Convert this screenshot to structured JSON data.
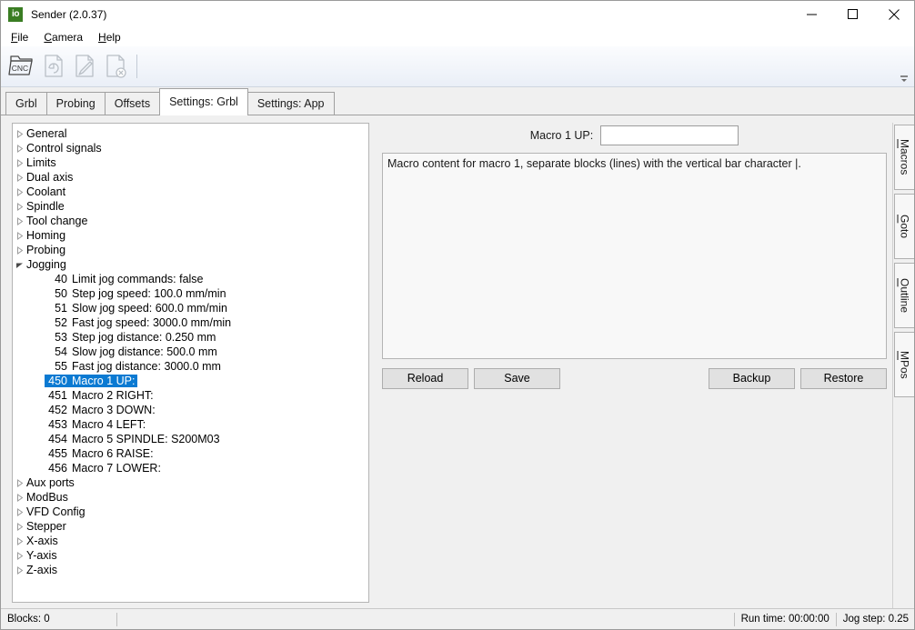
{
  "window": {
    "icon_text": "io",
    "title": "Sender (2.0.37)",
    "controls": {
      "minimize": "minimize-icon",
      "maximize": "maximize-icon",
      "close": "close-icon"
    }
  },
  "menubar": {
    "items": [
      {
        "mnemonic": "F",
        "rest": "ile"
      },
      {
        "mnemonic": "C",
        "rest": "amera"
      },
      {
        "mnemonic": "H",
        "rest": "elp"
      }
    ]
  },
  "toolbar": {
    "buttons": [
      {
        "name": "open-cnc-file-icon",
        "label": "CNC"
      },
      {
        "name": "reload-file-icon",
        "label": ""
      },
      {
        "name": "edit-file-icon",
        "label": ""
      },
      {
        "name": "close-file-icon",
        "label": ""
      }
    ],
    "overflow": "toolbar-overflow-icon"
  },
  "tabs": {
    "items": [
      {
        "label": "Grbl",
        "active": false
      },
      {
        "label": "Probing",
        "active": false
      },
      {
        "label": "Offsets",
        "active": false
      },
      {
        "label": "Settings: Grbl",
        "active": true
      },
      {
        "label": "Settings: App",
        "active": false
      }
    ]
  },
  "tree": {
    "nodes": [
      {
        "type": "group",
        "label": "General",
        "expanded": false
      },
      {
        "type": "group",
        "label": "Control signals",
        "expanded": false
      },
      {
        "type": "group",
        "label": "Limits",
        "expanded": false
      },
      {
        "type": "group",
        "label": "Dual axis",
        "expanded": false
      },
      {
        "type": "group",
        "label": "Coolant",
        "expanded": false
      },
      {
        "type": "group",
        "label": "Spindle",
        "expanded": false
      },
      {
        "type": "group",
        "label": "Tool change",
        "expanded": false
      },
      {
        "type": "group",
        "label": "Homing",
        "expanded": false
      },
      {
        "type": "group",
        "label": "Probing",
        "expanded": false
      },
      {
        "type": "group",
        "label": "Jogging",
        "expanded": true
      },
      {
        "type": "item",
        "num": "40",
        "label": "Limit jog commands: false",
        "selected": false
      },
      {
        "type": "item",
        "num": "50",
        "label": "Step jog speed: 100.0  mm/min",
        "selected": false
      },
      {
        "type": "item",
        "num": "51",
        "label": "Slow jog speed: 600.0  mm/min",
        "selected": false
      },
      {
        "type": "item",
        "num": "52",
        "label": "Fast jog speed: 3000.0  mm/min",
        "selected": false
      },
      {
        "type": "item",
        "num": "53",
        "label": "Step jog distance: 0.250  mm",
        "selected": false
      },
      {
        "type": "item",
        "num": "54",
        "label": "Slow jog distance: 500.0  mm",
        "selected": false
      },
      {
        "type": "item",
        "num": "55",
        "label": "Fast jog distance: 3000.0  mm",
        "selected": false
      },
      {
        "type": "item",
        "num": "450",
        "label": "Macro 1 UP:",
        "selected": true
      },
      {
        "type": "item",
        "num": "451",
        "label": "Macro 2 RIGHT:",
        "selected": false
      },
      {
        "type": "item",
        "num": "452",
        "label": "Macro 3 DOWN:",
        "selected": false
      },
      {
        "type": "item",
        "num": "453",
        "label": "Macro 4 LEFT:",
        "selected": false
      },
      {
        "type": "item",
        "num": "454",
        "label": "Macro 5 SPINDLE: S200M03",
        "selected": false
      },
      {
        "type": "item",
        "num": "455",
        "label": "Macro 6 RAISE:",
        "selected": false
      },
      {
        "type": "item",
        "num": "456",
        "label": "Macro 7 LOWER:",
        "selected": false
      },
      {
        "type": "group",
        "label": "Aux ports",
        "expanded": false
      },
      {
        "type": "group",
        "label": "ModBus",
        "expanded": false
      },
      {
        "type": "group",
        "label": "VFD Config",
        "expanded": false
      },
      {
        "type": "group",
        "label": "Stepper",
        "expanded": false
      },
      {
        "type": "group",
        "label": "X-axis",
        "expanded": false
      },
      {
        "type": "group",
        "label": "Y-axis",
        "expanded": false
      },
      {
        "type": "group",
        "label": "Z-axis",
        "expanded": false
      }
    ]
  },
  "detail": {
    "field_label": "Macro 1 UP:",
    "field_value": "",
    "field_placeholder": "",
    "description": "Macro content for macro 1, separate blocks (lines) with the vertical bar character |.",
    "buttons": {
      "reload": "Reload",
      "save": "Save",
      "backup": "Backup",
      "restore": "Restore"
    }
  },
  "vrail": {
    "tabs": [
      {
        "mnemonic": "M",
        "rest": "acros"
      },
      {
        "mnemonic": "G",
        "rest": "oto"
      },
      {
        "mnemonic": "O",
        "rest": "utline"
      },
      {
        "mnemonic": "M",
        "rest": "Pos"
      }
    ]
  },
  "statusbar": {
    "blocks": "Blocks: 0",
    "runtime": "Run time: 00:00:00",
    "jogstep": "Jog step: 0.25"
  },
  "colors": {
    "selection": "#0b7ad2",
    "accent_logo": "#3a7d23"
  }
}
